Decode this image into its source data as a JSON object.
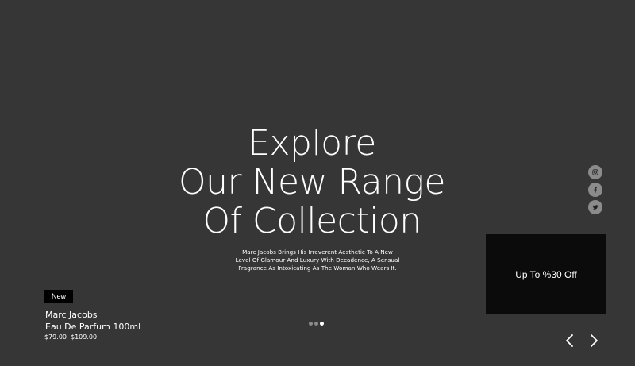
{
  "hero": {
    "title_lines": [
      "Explore",
      "Our New Range",
      "Of Collection"
    ],
    "description_lines": [
      "Marc Jacobs Brings His Irreverent Aesthetic To A New",
      "Level Of Glamour And Luxury With Decadence, A Sensual",
      "Fragrance As Intoxicating As The Woman Who Wears It."
    ]
  },
  "social": {
    "items": [
      {
        "name": "instagram",
        "icon": "instagram-icon"
      },
      {
        "name": "facebook",
        "icon": "facebook-icon"
      },
      {
        "name": "twitter",
        "icon": "twitter-icon"
      }
    ]
  },
  "promo": {
    "label": "Up To %30 Off"
  },
  "product": {
    "badge": "New",
    "brand": "Marc Jacobs",
    "name": "Eau De Parfum 100ml",
    "price": "$79.00",
    "old_price": "$109.00"
  },
  "carousel": {
    "slide_count": 3,
    "active_index": 2,
    "prev_icon": "chevron-left-icon",
    "next_icon": "chevron-right-icon"
  },
  "colors": {
    "background": "#363636",
    "promo_background": "#0b0b0b",
    "badge_background": "#000000",
    "social_button": "#8b8b8b",
    "dot_inactive": "#8a8a8a",
    "dot_active": "#ffffff",
    "text": "#ffffff"
  }
}
